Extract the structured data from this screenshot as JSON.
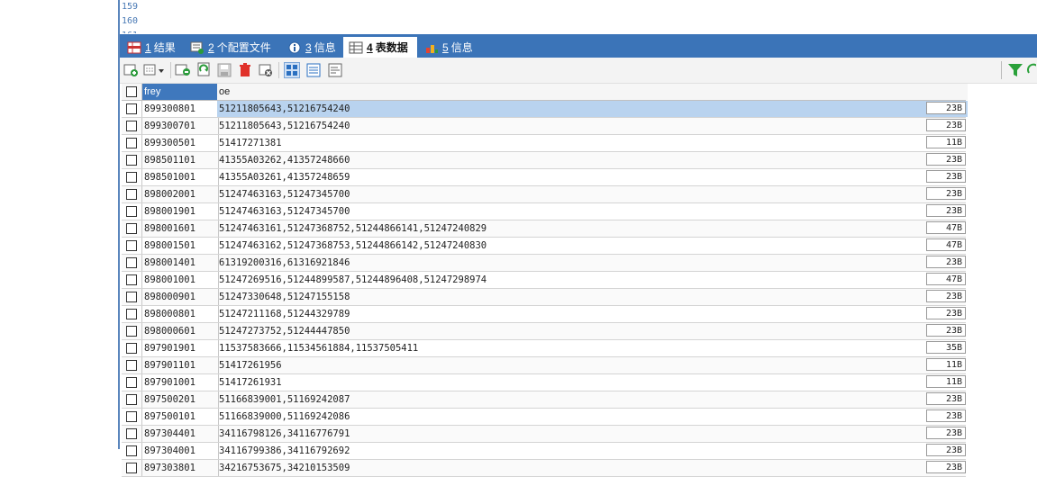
{
  "editor": {
    "lines": [
      "159",
      "160"
    ]
  },
  "tabs": [
    {
      "number": "1",
      "label": "结果",
      "icon": "grid-icon",
      "active": false
    },
    {
      "number": "2",
      "label": "个配置文件",
      "icon": "profile-icon",
      "active": false
    },
    {
      "number": "3",
      "label": "信息",
      "icon": "info-icon",
      "active": false
    },
    {
      "number": "4",
      "label": "表数据",
      "icon": "table-icon",
      "active": true
    },
    {
      "number": "5",
      "label": "信息",
      "icon": "chart-icon",
      "active": false
    }
  ],
  "grid": {
    "columns": [
      "frey",
      "oe"
    ],
    "rows": [
      {
        "frey": "899300801",
        "oe": "51211805643,51216754240",
        "size": "23B"
      },
      {
        "frey": "899300701",
        "oe": "51211805643,51216754240",
        "size": "23B"
      },
      {
        "frey": "899300501",
        "oe": "51417271381",
        "size": "11B"
      },
      {
        "frey": "898501101",
        "oe": "41355A03262,41357248660",
        "size": "23B"
      },
      {
        "frey": "898501001",
        "oe": "41355A03261,41357248659",
        "size": "23B"
      },
      {
        "frey": "898002001",
        "oe": "51247463163,51247345700",
        "size": "23B"
      },
      {
        "frey": "898001901",
        "oe": "51247463163,51247345700",
        "size": "23B"
      },
      {
        "frey": "898001601",
        "oe": "51247463161,51247368752,51244866141,51247240829",
        "size": "47B"
      },
      {
        "frey": "898001501",
        "oe": "51247463162,51247368753,51244866142,51247240830",
        "size": "47B"
      },
      {
        "frey": "898001401",
        "oe": "61319200316,61316921846",
        "size": "23B"
      },
      {
        "frey": "898001001",
        "oe": "51247269516,51244899587,51244896408,51247298974",
        "size": "47B"
      },
      {
        "frey": "898000901",
        "oe": "51247330648,51247155158",
        "size": "23B"
      },
      {
        "frey": "898000801",
        "oe": "51247211168,51244329789",
        "size": "23B"
      },
      {
        "frey": "898000601",
        "oe": "51247273752,51244447850",
        "size": "23B"
      },
      {
        "frey": "897901901",
        "oe": "11537583666,11534561884,11537505411",
        "size": "35B"
      },
      {
        "frey": "897901101",
        "oe": "51417261956",
        "size": "11B"
      },
      {
        "frey": "897901001",
        "oe": "51417261931",
        "size": "11B"
      },
      {
        "frey": "897500201",
        "oe": "51166839001,51169242087",
        "size": "23B"
      },
      {
        "frey": "897500101",
        "oe": "51166839000,51169242086",
        "size": "23B"
      },
      {
        "frey": "897304401",
        "oe": "34116798126,34116776791",
        "size": "23B"
      },
      {
        "frey": "897304001",
        "oe": "34116799386,34116792692",
        "size": "23B"
      },
      {
        "frey": "897303801",
        "oe": "34216753675,34210153509",
        "size": "23B"
      }
    ]
  },
  "colors": {
    "tabbar": "#3b74b8",
    "selected": "#b9d3ef",
    "header_active": "#3f78bd"
  }
}
